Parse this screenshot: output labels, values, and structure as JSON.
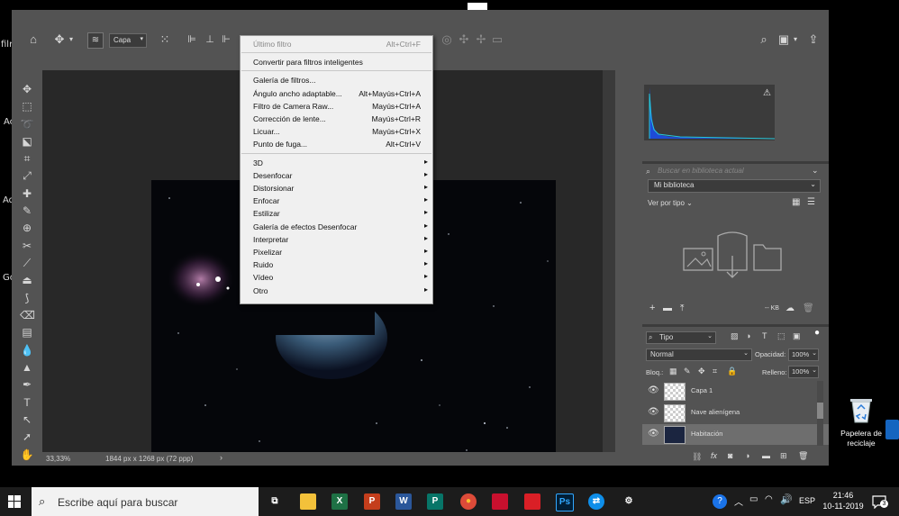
{
  "desktop": {
    "left_labels": [
      "filr",
      "Ac",
      "Ad",
      "Go"
    ],
    "recycle_bin_label": "Papelera de reciclaje"
  },
  "photoshop": {
    "options": {
      "layer_select": "Capa"
    },
    "status": {
      "zoom": "33,33%",
      "doc_info": "1844 px x 1268 px (72 ppp)"
    }
  },
  "filter_menu": {
    "top": [
      {
        "label": "Último filtro",
        "shortcut": "Alt+Ctrl+F",
        "disabled": true
      }
    ],
    "smart": [
      {
        "label": "Convertir para filtros inteligentes"
      }
    ],
    "filters": [
      {
        "label": "Galería de filtros...",
        "shortcut": ""
      },
      {
        "label": "Ángulo ancho adaptable...",
        "shortcut": "Alt+Mayús+Ctrl+A"
      },
      {
        "label": "Filtro de Camera Raw...",
        "shortcut": "Mayús+Ctrl+A"
      },
      {
        "label": "Corrección de lente...",
        "shortcut": "Mayús+Ctrl+R"
      },
      {
        "label": "Licuar...",
        "shortcut": "Mayús+Ctrl+X"
      },
      {
        "label": "Punto de fuga...",
        "shortcut": "Alt+Ctrl+V"
      }
    ],
    "submenus": [
      "3D",
      "Desenfocar",
      "Distorsionar",
      "Enfocar",
      "Estilizar",
      "Galería de efectos Desenfocar",
      "Interpretar",
      "Pixelizar",
      "Ruido",
      "Vídeo",
      "Otro"
    ]
  },
  "libraries": {
    "search_placeholder": "Buscar en biblioteca actual",
    "library_select": "Mi biblioteca",
    "view_by": "Ver por tipo",
    "size": "-- KB"
  },
  "layers": {
    "filter_type": "Tipo",
    "blend_mode": "Normal",
    "opacity_label": "Opacidad:",
    "opacity_value": "100%",
    "lock_label": "Bloq.:",
    "fill_label": "Relleno:",
    "fill_value": "100%",
    "items": [
      {
        "name": "Capa 1",
        "visible": true
      },
      {
        "name": "Nave alienígena",
        "visible": true
      },
      {
        "name": "Habitación",
        "visible": true,
        "selected": true
      }
    ]
  },
  "taskbar": {
    "search_placeholder": "Escribe aquí para buscar",
    "language": "ESP",
    "time": "21:46",
    "date": "10-11-2019",
    "notification_count": "3",
    "apps": [
      {
        "icon": "task-view-icon"
      },
      {
        "icon": "file-explorer-icon",
        "color": "#f3c13a"
      },
      {
        "icon": "excel-icon",
        "color": "#1e7145",
        "letter": "X"
      },
      {
        "icon": "powerpoint-icon",
        "color": "#c43e1c",
        "letter": "P"
      },
      {
        "icon": "word-icon",
        "color": "#2b579a",
        "letter": "W"
      },
      {
        "icon": "publisher-icon",
        "color": "#077568",
        "letter": "P"
      },
      {
        "icon": "chrome-icon",
        "color": "#dd4b39"
      },
      {
        "icon": "acrobat-icon",
        "color": "#c8102e"
      },
      {
        "icon": "creative-cloud-icon",
        "color": "#da1f26"
      },
      {
        "icon": "photoshop-icon",
        "color": "#001e36",
        "letter": "Ps"
      },
      {
        "icon": "teamviewer-icon",
        "color": "#0e8ee9"
      },
      {
        "icon": "settings-icon",
        "color": "#ffffff"
      }
    ]
  }
}
